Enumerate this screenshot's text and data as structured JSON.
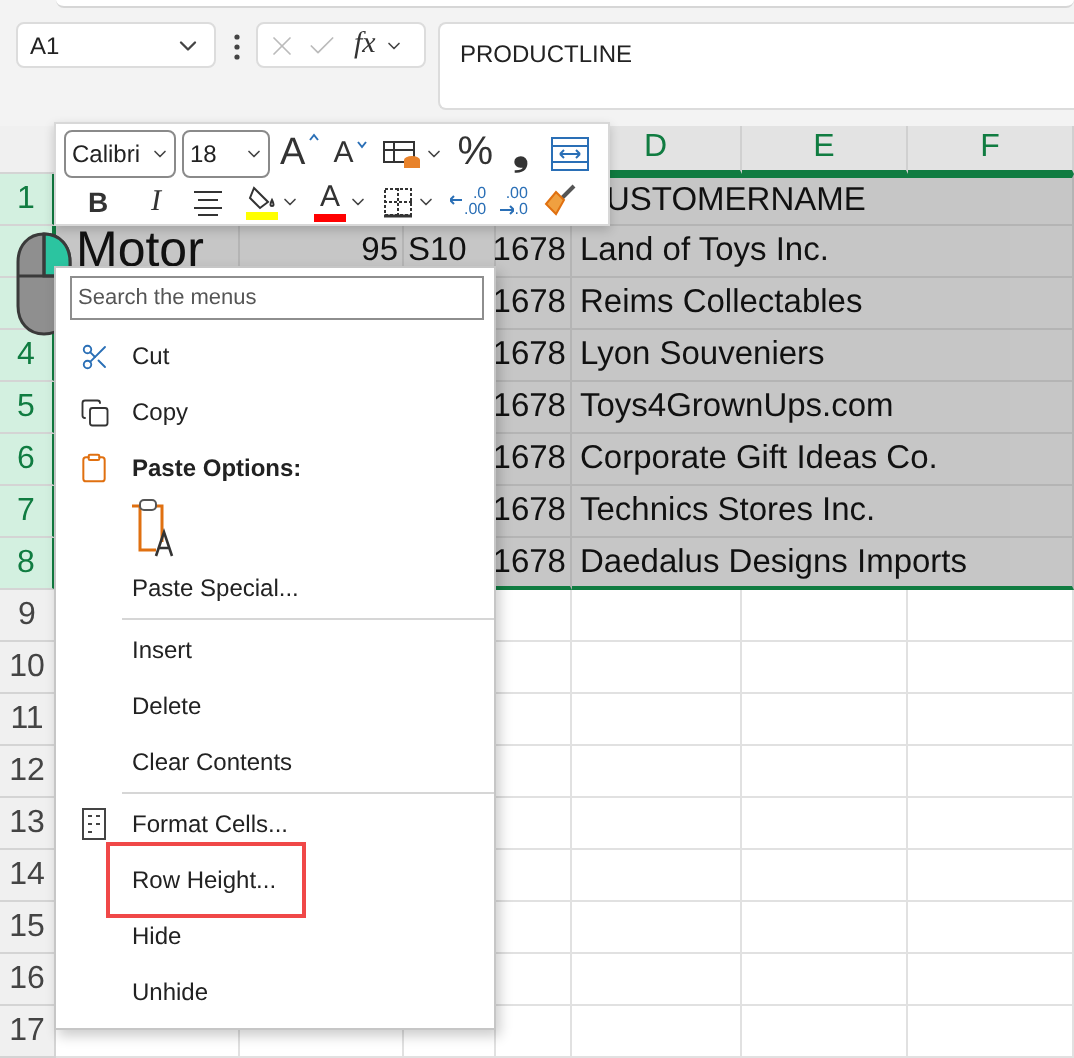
{
  "name_box": {
    "value": "A1"
  },
  "formula_bar": {
    "function_label": "fx",
    "value": "PRODUCTLINE"
  },
  "columns": [
    {
      "label": "D",
      "selected": true
    },
    {
      "label": "E",
      "selected": true
    },
    {
      "label": "F",
      "selected": true
    }
  ],
  "rows": [
    {
      "number": "1",
      "selected": true,
      "column_5": "USTOMERNAME"
    },
    {
      "selected": true,
      "column_1": "Motor",
      "column_1_large": true,
      "column_2": "95",
      "column_3": "S10",
      "column_4": "1678",
      "column_5": "Land of Toys Inc."
    },
    {
      "selected": true,
      "column_4": "1678",
      "column_5": "Reims Collectables"
    },
    {
      "number": "4",
      "selected": true,
      "column_4": "1678",
      "column_5": "Lyon Souveniers"
    },
    {
      "number": "5",
      "selected": true,
      "column_4": "1678",
      "column_5": "Toys4GrownUps.com"
    },
    {
      "number": "6",
      "selected": true,
      "column_4": "1678",
      "column_5": "Corporate Gift Ideas Co."
    },
    {
      "number": "7",
      "selected": true,
      "column_4": "1678",
      "column_5": "Technics Stores Inc."
    },
    {
      "number": "8",
      "selected": true,
      "column_4": "1678",
      "column_5": "Daedalus Designs Imports"
    },
    {
      "number": "9",
      "selected": false
    },
    {
      "number": "10",
      "selected": false
    },
    {
      "number": "11",
      "selected": false
    },
    {
      "number": "12",
      "selected": false
    },
    {
      "number": "13",
      "selected": false
    },
    {
      "number": "14",
      "selected": false
    },
    {
      "number": "15",
      "selected": false
    },
    {
      "number": "16",
      "selected": false
    },
    {
      "number": "17",
      "selected": false
    }
  ],
  "mini_toolbar": {
    "font": "Calibri",
    "size": "18",
    "row_1": [
      {
        "kind": "grow_font",
        "glyph": "A"
      },
      {
        "kind": "shrink_font",
        "glyph": "A"
      },
      {
        "kind": "table_styles",
        "dropdown": true
      },
      {
        "kind": "percent",
        "glyph": "%"
      },
      {
        "kind": "comma",
        "glyph": "❟"
      },
      {
        "kind": "wrap"
      }
    ],
    "row_2": [
      {
        "kind": "bold",
        "glyph": "B"
      },
      {
        "kind": "italic",
        "glyph": "I"
      },
      {
        "kind": "align"
      },
      {
        "kind": "fill_color",
        "color": "#ffff00",
        "dropdown": true
      },
      {
        "kind": "font_color",
        "glyph": "A",
        "color": "#ff0000",
        "dropdown": true
      },
      {
        "kind": "borders",
        "dropdown": true
      },
      {
        "kind": "decrease_decimal",
        "lines": [
          ".0",
          ".00"
        ]
      },
      {
        "kind": "increase_decimal",
        "lines": [
          ".00",
          ".0"
        ]
      },
      {
        "kind": "format_painter"
      }
    ]
  },
  "context_menu": {
    "search": {
      "placeholder": "Search the menus"
    },
    "items": [
      {
        "kind": "icon_item",
        "label": "Cut",
        "highlighted": false
      },
      {
        "kind": "icon_item",
        "label": "Copy",
        "highlighted": false
      },
      {
        "kind": "header",
        "label": "Paste Options:"
      },
      {
        "kind": "paste_choice"
      },
      {
        "kind": "item",
        "label": "Paste Special...",
        "highlighted": false
      },
      {
        "kind": "separator"
      },
      {
        "kind": "item",
        "label": "Insert",
        "highlighted": false
      },
      {
        "kind": "item",
        "label": "Delete",
        "highlighted": false
      },
      {
        "kind": "item",
        "label": "Clear Contents",
        "highlighted": false
      },
      {
        "kind": "separator"
      },
      {
        "kind": "icon_item",
        "label": "Format Cells...",
        "highlighted": false
      },
      {
        "kind": "item",
        "label": "Row Height...",
        "highlighted": true
      },
      {
        "kind": "item",
        "label": "Hide",
        "highlighted": false
      },
      {
        "kind": "item",
        "label": "Unhide",
        "highlighted": false
      }
    ]
  }
}
